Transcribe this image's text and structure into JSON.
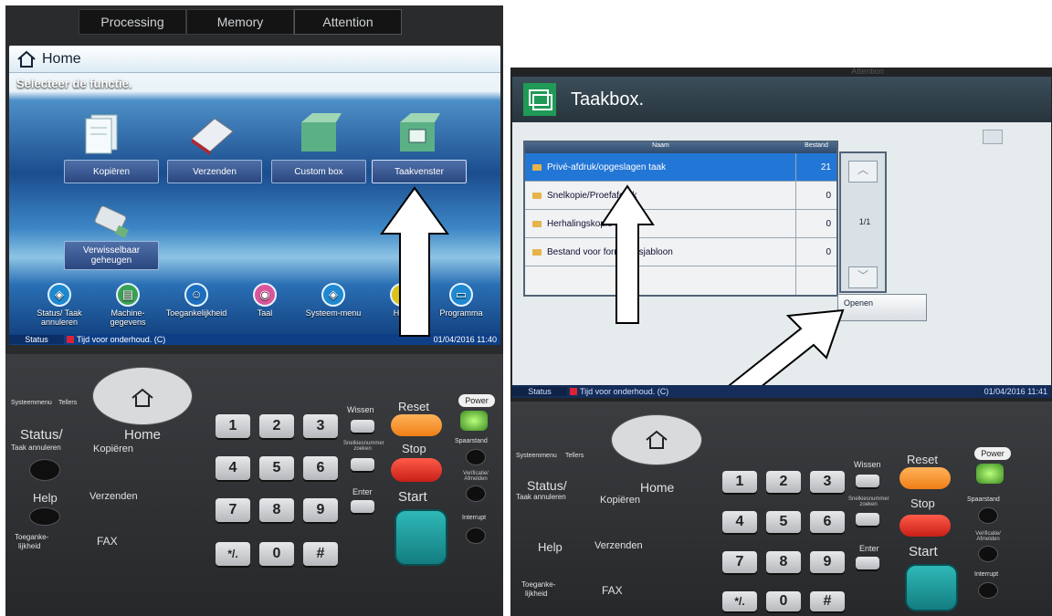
{
  "left": {
    "status_leds": [
      "Processing",
      "Memory",
      "Attention"
    ],
    "screen": {
      "title": "Home",
      "subtitle": "Selecteer de functie.",
      "functions": [
        "Kopiëren",
        "Verzenden",
        "Custom box",
        "Taakvenster",
        "Verwisselbaar geheugen"
      ],
      "bottom_items": [
        "Status/ Taak annuleren",
        "Machine-gegevens",
        "Toegankelijkheid",
        "Taal",
        "Systeem-menu",
        "Help",
        "Programma"
      ],
      "status_label": "Status",
      "status_message": "Tijd voor onderhoud. (C)",
      "datetime": "01/04/2016 11:40"
    },
    "panel": {
      "top_labels": [
        "Systeemmenu",
        "Tellers"
      ],
      "home": "Home",
      "status": "Status/",
      "status_sub": "Taak annuleren",
      "kopieren": "Kopiëren",
      "help": "Help",
      "verzenden": "Verzenden",
      "toeganke": "Toeganke-",
      "lijkheid": "lijkheid",
      "fax": "FAX",
      "keys": [
        "1",
        "2",
        "3",
        "4",
        "5",
        "6",
        "7",
        "8",
        "9",
        "*/.",
        "0",
        "#"
      ],
      "wissen": "Wissen",
      "snelkies": "Snelkiesnummer zoeken",
      "enter": "Enter",
      "reset": "Reset",
      "stop": "Stop",
      "start": "Start",
      "power": "Power",
      "spaarstand": "Spaarstand",
      "verificatie": "Verificatie/ Afmelden",
      "interrupt": "Interrupt"
    }
  },
  "right": {
    "status_leds": [
      "Attention"
    ],
    "screen": {
      "title": "Taakbox.",
      "col_name": "Naam",
      "col_count": "Bestand",
      "rows": [
        {
          "name": "Privé-afdruk/opgeslagen taak",
          "count": "21"
        },
        {
          "name": "Snelkopie/Proefafdruk",
          "count": "0"
        },
        {
          "name": "Herhalingskopie",
          "count": "0"
        },
        {
          "name": "Bestand voor formuliersjabloon",
          "count": "0"
        }
      ],
      "page": "1/1",
      "open_button": "Openen",
      "status_label": "Status",
      "status_message": "Tijd voor onderhoud. (C)",
      "datetime": "01/04/2016 11:41"
    },
    "panel": {
      "top_labels": [
        "Systeemmenu",
        "Tellers"
      ],
      "home": "Home",
      "status": "Status/",
      "status_sub": "Taak annuleren",
      "kopieren": "Kopiëren",
      "help": "Help",
      "verzenden": "Verzenden",
      "toeganke": "Toeganke-",
      "lijkheid": "lijkheid",
      "fax": "FAX",
      "keys": [
        "1",
        "2",
        "3",
        "4",
        "5",
        "6",
        "7",
        "8",
        "9",
        "*/.",
        "0",
        "#"
      ],
      "wissen": "Wissen",
      "snelkies": "Snelkiesnummer zoeken",
      "enter": "Enter",
      "reset": "Reset",
      "stop": "Stop",
      "start": "Start",
      "power": "Power",
      "spaarstand": "Spaarstand",
      "verificatie": "Verificatie/ Afmelden",
      "interrupt": "Interrupt"
    }
  }
}
